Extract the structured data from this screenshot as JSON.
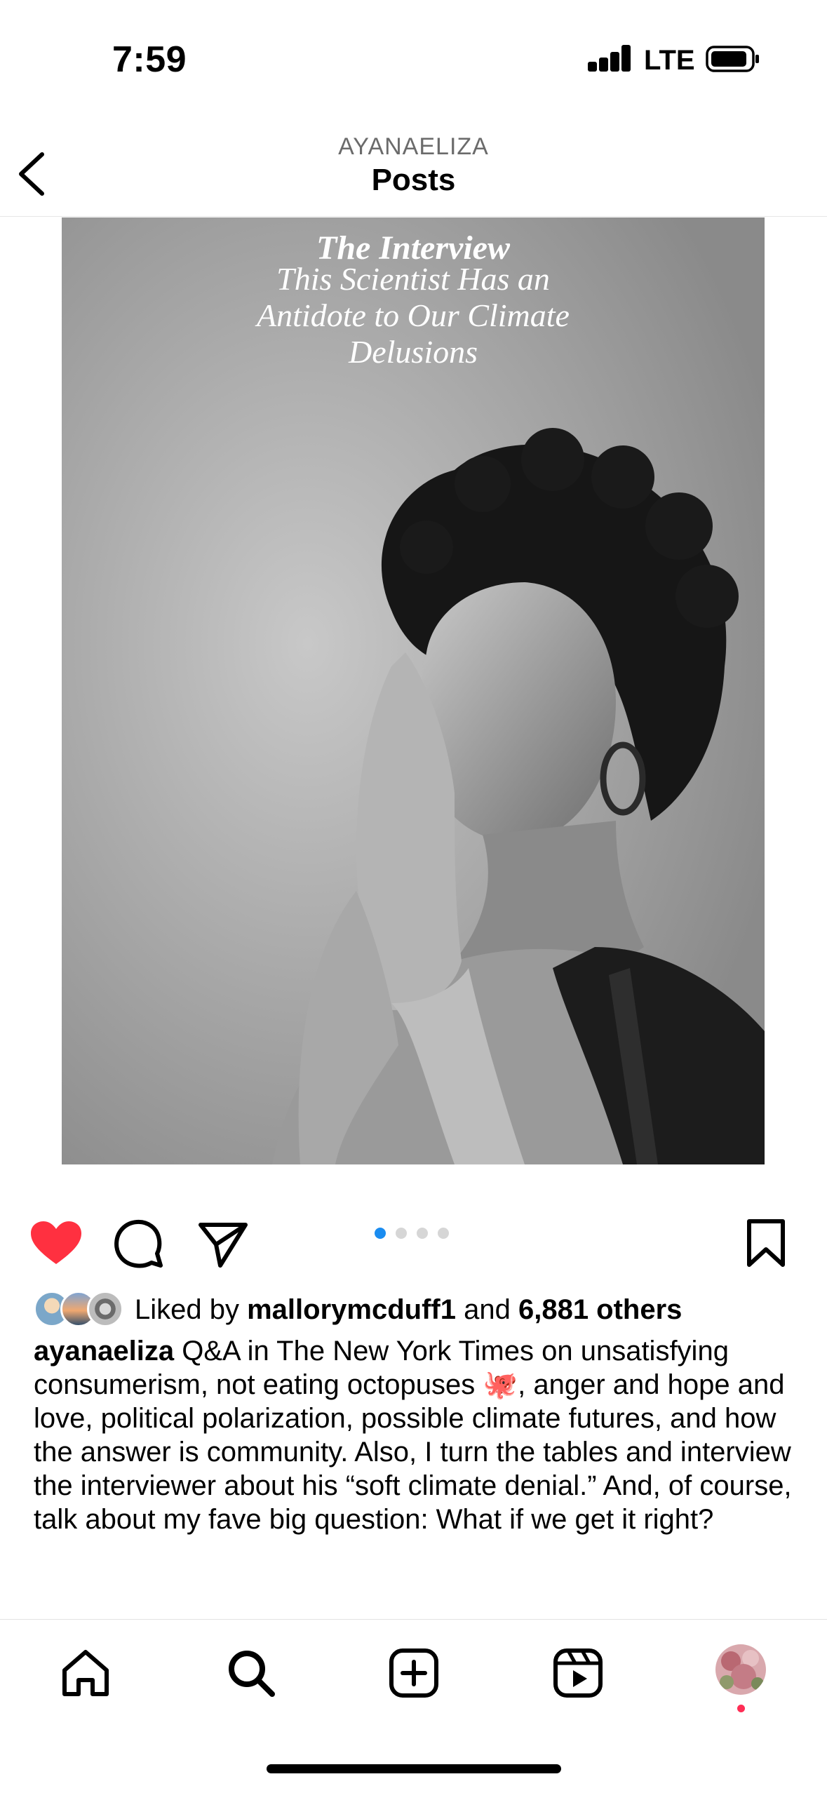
{
  "status_bar": {
    "time": "7:59",
    "network": "LTE"
  },
  "header": {
    "username": "AYANAELIZA",
    "title": "Posts"
  },
  "post": {
    "overlay_kicker": "The Interview",
    "overlay_headline": "This Scientist Has an Antidote to Our Climate Delusions",
    "carousel": {
      "count": 4,
      "active_index": 0
    },
    "liked_state": true,
    "likes": {
      "prefix": "Liked by",
      "user": "mallorymcduff1",
      "connector": "and",
      "others": "6,881 others"
    },
    "caption": {
      "username": "ayanaeliza",
      "text": "Q&A in The New York Times on unsatisfying consumerism, not eating octopuses 🐙, anger and hope and love, political polarization, possible climate futures, and how the answer is community. Also, I turn the tables and interview the interviewer about his “soft climate denial.” And, of course, talk about my fave big question: What if we get it right?"
    }
  },
  "icons": {
    "back": "chevron-left-icon",
    "like": "heart-icon",
    "comment": "comment-icon",
    "share": "paper-plane-icon",
    "save": "bookmark-icon",
    "nav": [
      "home-icon",
      "search-icon",
      "create-icon",
      "reels-icon",
      "profile-avatar"
    ]
  },
  "colors": {
    "like_red": "#ff3040",
    "dot_active": "#1a8cf0",
    "notification": "#ff2d55"
  }
}
